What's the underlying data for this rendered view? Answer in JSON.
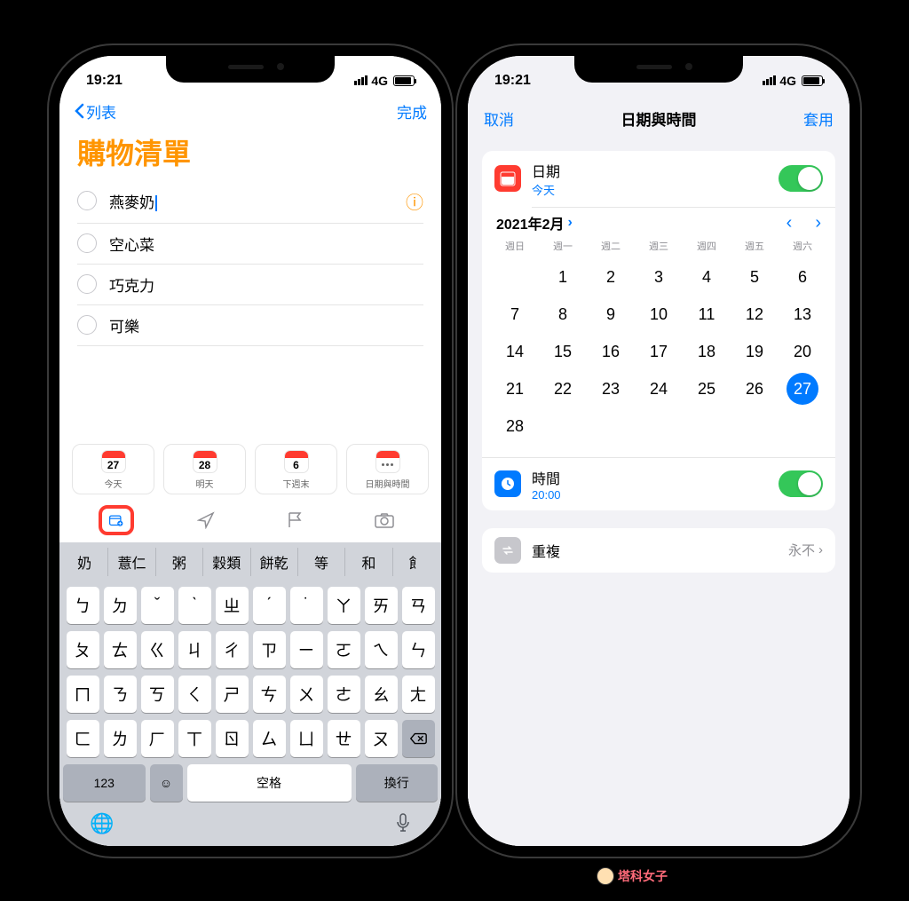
{
  "status": {
    "time": "19:21",
    "network": "4G"
  },
  "left": {
    "back": "列表",
    "done": "完成",
    "title": "購物清單",
    "items": [
      "燕麥奶",
      "空心菜",
      "巧克力",
      "可樂"
    ],
    "quick": [
      {
        "num": "27",
        "label": "今天"
      },
      {
        "num": "28",
        "label": "明天"
      },
      {
        "num": "6",
        "label": "下週末"
      },
      {
        "num": "",
        "label": "日期與時間"
      }
    ],
    "suggest": [
      "奶",
      "薏仁",
      "粥",
      "穀類",
      "餅乾",
      "等",
      "和",
      "飠"
    ],
    "keys": {
      "r1": [
        "ㄅ",
        "ㄉ",
        "ˇ",
        "ˋ",
        "ㄓ",
        "ˊ",
        "˙",
        "ㄚ",
        "ㄞ",
        "ㄢ"
      ],
      "r2": [
        "ㄆ",
        "ㄊ",
        "ㄍ",
        "ㄐ",
        "ㄔ",
        "ㄗ",
        "ㄧ",
        "ㄛ",
        "ㄟ",
        "ㄣ"
      ],
      "r3": [
        "ㄇ",
        "ㄋ",
        "ㄎ",
        "ㄑ",
        "ㄕ",
        "ㄘ",
        "ㄨ",
        "ㄜ",
        "ㄠ",
        "ㄤ"
      ],
      "r4": [
        "ㄈ",
        "ㄌ",
        "ㄏ",
        "ㄒ",
        "ㄖ",
        "ㄙ",
        "ㄩ",
        "ㄝ",
        "ㄡ"
      ],
      "num": "123",
      "space": "空格",
      "enter": "換行"
    }
  },
  "right": {
    "cancel": "取消",
    "title": "日期與時間",
    "apply": "套用",
    "date_label": "日期",
    "date_sub": "今天",
    "month": "2021年2月",
    "weekdays": [
      "週日",
      "週一",
      "週二",
      "週三",
      "週四",
      "週五",
      "週六"
    ],
    "days": [
      "",
      "1",
      "2",
      "3",
      "4",
      "5",
      "6",
      "7",
      "8",
      "9",
      "10",
      "11",
      "12",
      "13",
      "14",
      "15",
      "16",
      "17",
      "18",
      "19",
      "20",
      "21",
      "22",
      "23",
      "24",
      "25",
      "26",
      "27",
      "28"
    ],
    "selected": "27",
    "time_label": "時間",
    "time_value": "20:00",
    "repeat_label": "重複",
    "repeat_value": "永不"
  },
  "watermark": "塔科女子"
}
